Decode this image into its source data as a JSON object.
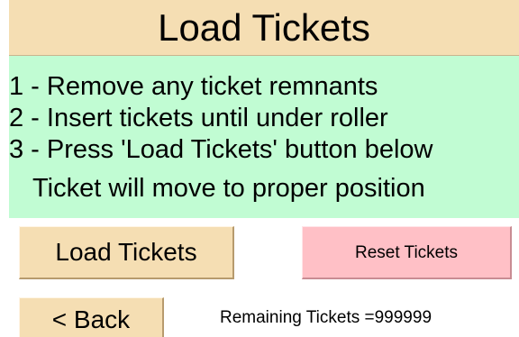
{
  "header": {
    "title": "Load Tickets"
  },
  "instructions": {
    "steps": [
      "1 - Remove any ticket remnants",
      "2 - Insert tickets until under roller",
      "3 - Press 'Load Tickets' button below"
    ],
    "note": "Ticket will move to proper position"
  },
  "buttons": {
    "load_label": "Load Tickets",
    "reset_label": "Reset Tickets",
    "back_label": "< Back"
  },
  "status": {
    "remaining_text": "Remaining Tickets =999999"
  },
  "colors": {
    "header_bg": "#f5deb3",
    "instructions_bg": "#c1fcd3",
    "load_button_bg": "#f5deb3",
    "reset_button_bg": "#ffc0c6",
    "back_button_bg": "#f5deb3"
  }
}
